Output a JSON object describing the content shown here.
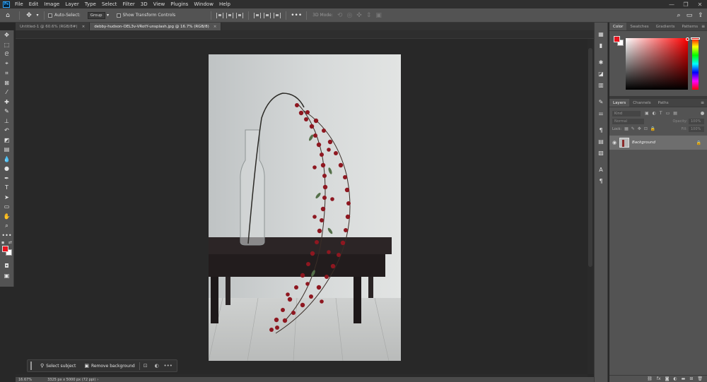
{
  "app": {
    "logo": "Ps"
  },
  "menu": [
    "File",
    "Edit",
    "Image",
    "Layer",
    "Type",
    "Select",
    "Filter",
    "3D",
    "View",
    "Plugins",
    "Window",
    "Help"
  ],
  "window_controls": [
    "—",
    "❐",
    "✕"
  ],
  "options": {
    "auto_select_label": "Auto-Select:",
    "auto_select_value": "Group",
    "transform_label": "Show Transform Controls",
    "more": "•••"
  },
  "tabs": [
    {
      "label": "Untitled-1 @ 60.6% (RGB/8#)",
      "active": false
    },
    {
      "label": "debby-hudson-OEL3v-VRotY-unsplash.jpg @ 16.7% (RGB/8)",
      "active": true
    }
  ],
  "tab_close": "×",
  "status": {
    "zoom": "16.67%",
    "info": "3325 px x 5000 px (72 ppi)"
  },
  "contextual_bar": {
    "select_subject": "Select subject",
    "remove_background": "Remove background",
    "more": "•••"
  },
  "color_panel": {
    "tabs": [
      "Color",
      "Swatches",
      "Gradients",
      "Patterns"
    ],
    "foreground": "#e8131d",
    "background": "#ffffff"
  },
  "layers_panel": {
    "tabs": [
      "Layers",
      "Channels",
      "Paths"
    ],
    "filter_placeholder": "Kind",
    "blend_mode": "Normal",
    "opacity_label": "Opacity:",
    "opacity_value": "100%",
    "lock_label": "Lock:",
    "fill_label": "Fill:",
    "fill_value": "100%",
    "layers": [
      {
        "name": "Background",
        "visible": true,
        "locked": true
      }
    ]
  },
  "panel_menu": "≡"
}
